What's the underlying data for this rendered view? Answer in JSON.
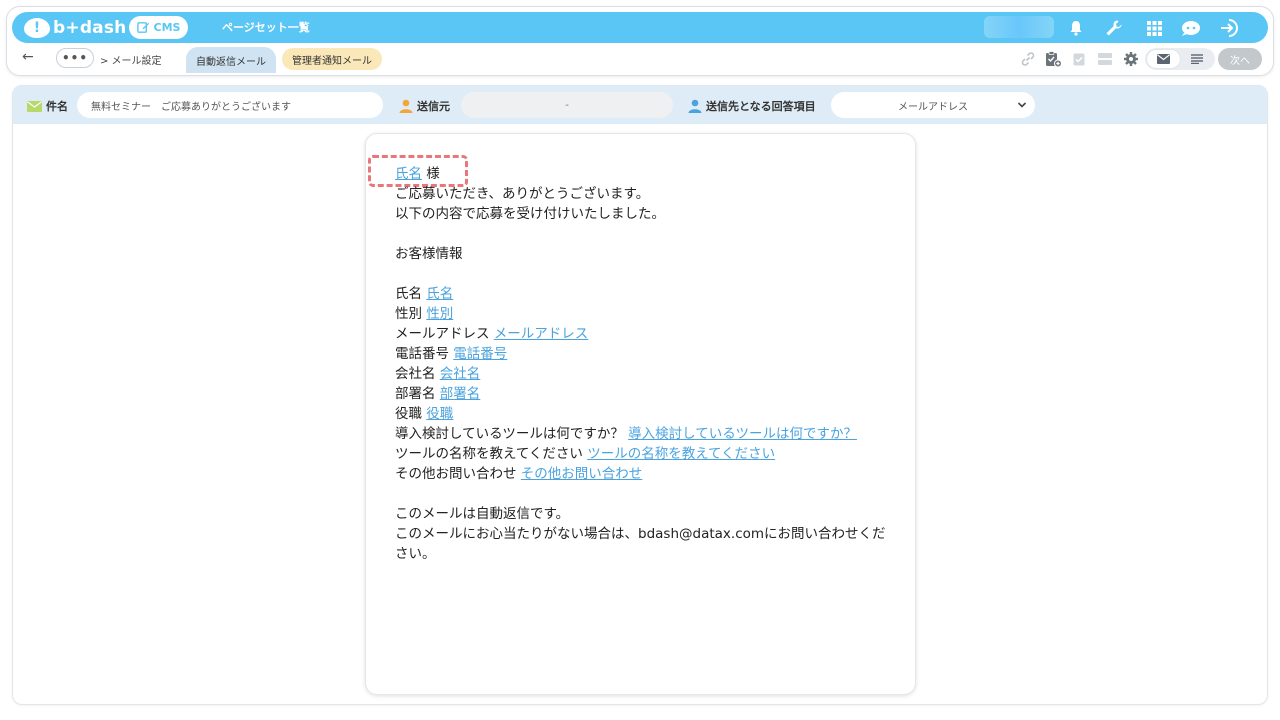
{
  "header": {
    "logo_text": "b+dash",
    "cms_label": "CMS",
    "page_set_link": "ページセット一覧"
  },
  "subbar": {
    "back": "←",
    "more": "•••",
    "breadcrumb": "> メール設定",
    "tabs": [
      {
        "label": "自動返信メール",
        "active": true
      },
      {
        "label": "管理者通知メール",
        "active": false
      }
    ],
    "next_label": "次へ"
  },
  "fields": {
    "subject_label": "件名",
    "subject_value": "無料セミナー　ご応募ありがとうございます",
    "sender_label": "送信元",
    "sender_value": "-",
    "recipient_label": "送信先となる回答項目",
    "recipient_value": "メールアドレス"
  },
  "email": {
    "greeting_var": "氏名",
    "greeting_suffix": "様",
    "intro_lines": [
      "ご応募いただき、ありがとうございます。",
      "以下の内容で応募を受け付けいたしました。"
    ],
    "section_title": "お客様情報",
    "rows": [
      {
        "label": "氏名",
        "var": "氏名"
      },
      {
        "label": "性別",
        "var": "性別"
      },
      {
        "label": "メールアドレス",
        "var": "メールアドレス"
      },
      {
        "label": "電話番号",
        "var": "電話番号"
      },
      {
        "label": "会社名",
        "var": "会社名"
      },
      {
        "label": "部署名",
        "var": "部署名"
      },
      {
        "label": "役職",
        "var": "役職"
      },
      {
        "label": "導入検討しているツールは何ですか？",
        "var": "導入検討しているツールは何ですか？"
      },
      {
        "label": "ツールの名称を教えてください",
        "var": "ツールの名称を教えてください"
      },
      {
        "label": "その他お問い合わせ",
        "var": "その他お問い合わせ"
      }
    ],
    "footer_lines": [
      "このメールは自動返信です。",
      "このメールにお心当たりがない場合は、bdash@datax.comにお問い合わせください。"
    ]
  },
  "colors": {
    "brand": "#5ac6f5",
    "link": "#4aa3df",
    "highlight": "#e8777a"
  }
}
